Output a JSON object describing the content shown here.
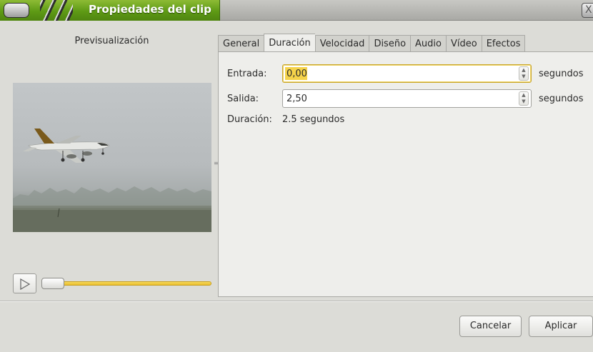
{
  "window": {
    "title": "Propiedades del clip",
    "close_glyph": "X"
  },
  "preview": {
    "label": "Previsualización",
    "play_icon": "play-icon"
  },
  "tabs": [
    {
      "label": "General",
      "active": false
    },
    {
      "label": "Duración",
      "active": true
    },
    {
      "label": "Velocidad",
      "active": false
    },
    {
      "label": "Diseño",
      "active": false
    },
    {
      "label": "Audio",
      "active": false
    },
    {
      "label": "Vídeo",
      "active": false
    },
    {
      "label": "Efectos",
      "active": false
    }
  ],
  "duration": {
    "in_label": "Entrada:",
    "in_value": "0,00",
    "out_label": "Salida:",
    "out_value": "2,50",
    "unit": "segundos",
    "length_label": "Duración:",
    "length_value": "2.5 segundos"
  },
  "buttons": {
    "cancel": "Cancelar",
    "apply": "Aplicar"
  },
  "colors": {
    "titlebar_accent": "#5e9a15",
    "focus_highlight": "#f5d34a",
    "scrub_fill": "#e9bd2c"
  }
}
